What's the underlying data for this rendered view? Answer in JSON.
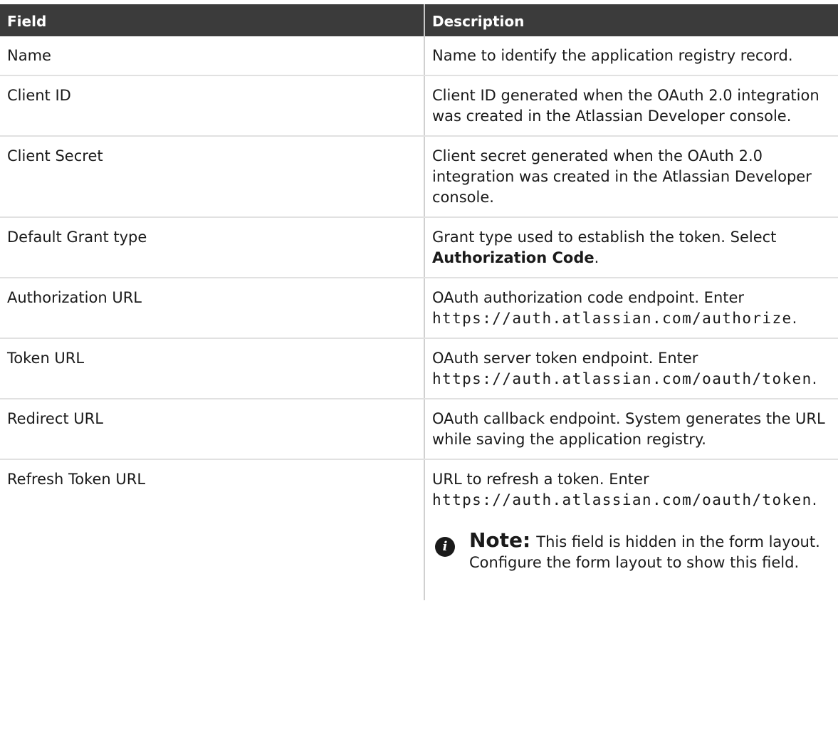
{
  "table": {
    "headers": {
      "field": "Field",
      "description": "Description"
    },
    "rows": [
      {
        "field": "Name",
        "desc_text": "Name to identify the application registry record."
      },
      {
        "field": "Client ID",
        "desc_text": "Client ID generated when the OAuth 2.0 integration was created in the Atlassian Developer console."
      },
      {
        "field": "Client Secret",
        "desc_text": "Client secret generated when the OAuth 2.0 integration was created in the Atlassian Developer console."
      },
      {
        "field": "Default Grant type",
        "desc_pre": "Grant type used to establish the token. Select ",
        "desc_bold": "Authorization Code",
        "desc_post": "."
      },
      {
        "field": "Authorization URL",
        "desc_pre": "OAuth authorization code endpoint. Enter ",
        "desc_code": "https://auth.atlassian.com/authorize",
        "desc_post": "."
      },
      {
        "field": "Token URL",
        "desc_pre": "OAuth server token endpoint. Enter ",
        "desc_code": "https://auth.atlassian.com/oauth/token",
        "desc_post": "."
      },
      {
        "field": "Redirect URL",
        "desc_text": "OAuth callback endpoint. System generates the URL while saving the application registry."
      },
      {
        "field": "Refresh Token URL",
        "desc_pre": "URL to refresh a token. Enter ",
        "desc_code": "https://auth.atlassian.com/oauth/token",
        "desc_post": ".",
        "note_label": "Note:",
        "note_text": "This field is hidden in the form layout. Configure the form layout to show this field."
      }
    ]
  },
  "icons": {
    "note_icon": "info-icon"
  }
}
